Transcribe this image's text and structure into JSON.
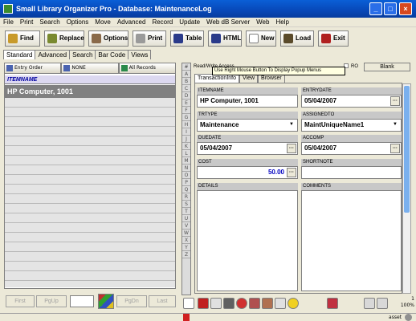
{
  "window": {
    "title": "Small Library Organizer Pro - Database: MaintenanceLog",
    "min": "_",
    "max": "□",
    "close": "×"
  },
  "menu": [
    "File",
    "Print",
    "Search",
    "Options",
    "Move",
    "Advanced",
    "Record",
    "Update",
    "Web dB Server",
    "Web",
    "Help"
  ],
  "toolbar": {
    "find": "Find",
    "replace": "Replace",
    "options": "Options",
    "print": "Print",
    "table": "Table",
    "html": "HTML",
    "new": "New",
    "load": "Load",
    "exit": "Exit"
  },
  "view_tabs": [
    "Standard",
    "Advanced",
    "Search",
    "Bar Code",
    "Views"
  ],
  "sort": {
    "entry_order": "Entry Order",
    "none": "NONE",
    "all_records": "All Records"
  },
  "list": {
    "column": "ITEMNAME",
    "selected_row": "HP Computer, 1001"
  },
  "nav": {
    "first": "First",
    "pgup": "PgUp",
    "pgdn": "PgDn",
    "last": "Last"
  },
  "letters": [
    "#",
    "A",
    "B",
    "C",
    "D",
    "E",
    "F",
    "G",
    "H",
    "I",
    "J",
    "K",
    "L",
    "M",
    "N",
    "O",
    "P",
    "Q",
    "R",
    "S",
    "T",
    "U",
    "V",
    "W",
    "X",
    "Y",
    "Z"
  ],
  "access": {
    "label": "Read/Write Access",
    "ro": "RO",
    "blank": "Blank"
  },
  "tooltip": "Use Right Mouse Button To Display Popup Menus",
  "section_tabs": [
    "TransactionInfo",
    "View",
    "Browser"
  ],
  "fields": {
    "itemname": {
      "label": "ITEMNAME",
      "value": "HP Computer, 1001"
    },
    "entrydate": {
      "label": "ENTRYDATE",
      "value": "05/04/2007"
    },
    "trtype": {
      "label": "TRTYPE",
      "value": "Maintenance"
    },
    "assignedto": {
      "label": "ASSIGNEDTO",
      "value": "MaintUniqueName1"
    },
    "duedate": {
      "label": "DUEDATE",
      "value": "05/04/2007"
    },
    "accomp": {
      "label": "ACCOMP",
      "value": "05/04/2007"
    },
    "cost": {
      "label": "COST",
      "value": "50.00"
    },
    "shortnote": {
      "label": "SHORTNOTE",
      "value": ""
    },
    "details": {
      "label": "DETAILS",
      "value": ""
    },
    "comments": {
      "label": "COMMENTS",
      "value": ""
    }
  },
  "status": {
    "right": "asset",
    "count": "1",
    "zoom": "100%"
  }
}
